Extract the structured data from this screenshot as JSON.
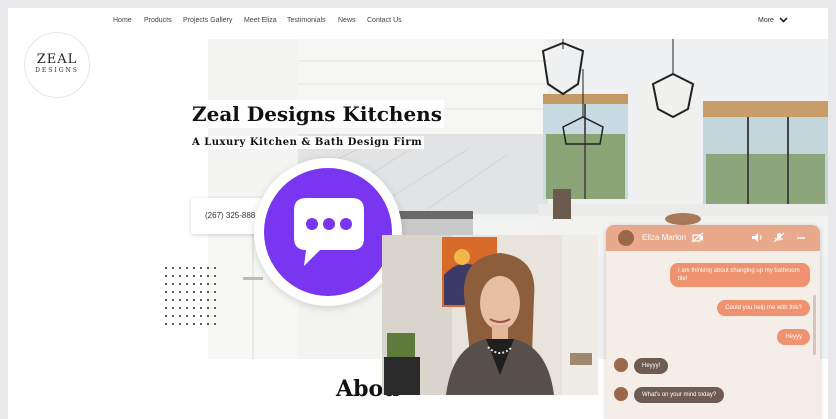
{
  "nav": {
    "items": [
      "Home",
      "Products",
      "Projects Gallery",
      "Meet Eliza",
      "Testimonials",
      "News",
      "Contact Us"
    ],
    "more_label": "More"
  },
  "logo": {
    "line1": "ZEAL",
    "line2": "DESIGNS"
  },
  "hero": {
    "title": "Zeal Designs Kitchens",
    "subtitle": "A Luxury Kitchen & Bath Design Firm",
    "phone": "(267) 325-888"
  },
  "about": {
    "heading": "Abou"
  },
  "chat": {
    "agent_name": "Eliza Marlon",
    "messages": [
      {
        "from": "user",
        "text": "I am thinking about changing up my bathroom tile!"
      },
      {
        "from": "user",
        "text": "Could you help me with this?"
      },
      {
        "from": "user",
        "text": "Heyyy"
      },
      {
        "from": "agent",
        "text": "Heyyy!"
      },
      {
        "from": "agent",
        "text": "What's on your mind today?"
      }
    ]
  },
  "colors": {
    "accent_purple": "#7a35f0",
    "chat_header": "#e8a98c",
    "user_bubble": "#ef9270",
    "agent_bubble": "#6f5b52"
  },
  "icons": [
    "chevron-down-icon",
    "chat-bubble-icon",
    "video-off-icon",
    "speaker-icon",
    "mic-off-icon",
    "minimize-icon"
  ]
}
